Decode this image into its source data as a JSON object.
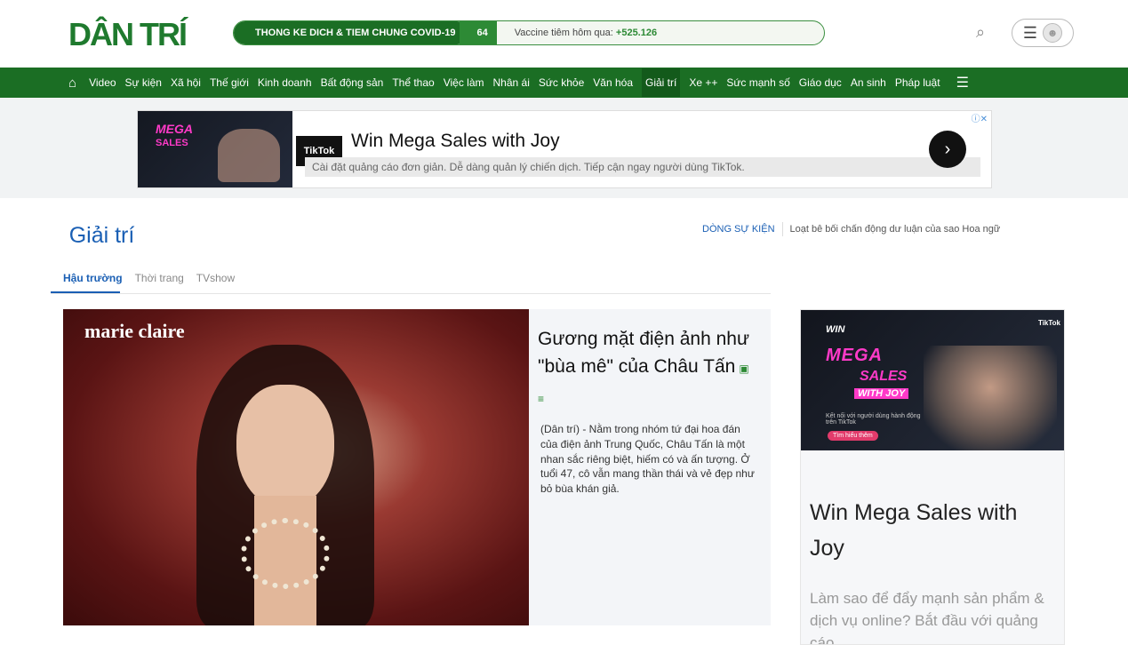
{
  "header": {
    "logo": "DÂN TRÍ",
    "covid_label": "THONG KE DICH & TIEM CHUNG COVID-19",
    "covid_count": "64",
    "vaccine_label": "Vaccine tiêm hôm qua:",
    "vaccine_value": "+525.126",
    "search_icon": "search-icon",
    "menu_icon": "hamburger-icon",
    "user_icon": "user-icon"
  },
  "nav": {
    "items": [
      "Video",
      "Sự kiện",
      "Xã hội",
      "Thế giới",
      "Kinh doanh",
      "Bất động sản",
      "Thể thao",
      "Việc làm",
      "Nhân ái",
      "Sức khỏe",
      "Văn hóa",
      "Giải trí",
      "Xe ++",
      "Sức mạnh số",
      "Giáo dục",
      "An sinh",
      "Pháp luật"
    ],
    "active": "Giải trí"
  },
  "top_ad": {
    "brand": "TikTok",
    "headline": "Win Mega Sales with Joy",
    "sub": "Cài đặt quảng cáo đơn giản. Dễ dàng quản lý chiến dịch. Tiếp cận ngay người dùng TikTok.",
    "img_line1": "MEGA",
    "img_line2": "SALES"
  },
  "section": {
    "title": "Giải trí",
    "event_tag": "DÒNG SỰ KIỆN",
    "event_text": "Loạt bê bối chấn động dư luận của sao Hoa ngữ",
    "tabs": [
      "Hậu trường",
      "Thời trang",
      "TVshow"
    ]
  },
  "article": {
    "photo_brand": "marie claire",
    "title": "Gương mặt điện ảnh như \"bùa mê\" của Châu Tấn",
    "summary": "(Dân trí) - Nằm trong nhóm tứ đại hoa đán của điện ảnh Trung Quốc, Châu Tấn là một nhan sắc riêng biệt, hiếm có và ấn tượng. Ở tuổi 47, cô vẫn mang thần thái và vẻ đẹp như bỏ bùa khán giả."
  },
  "side_ad": {
    "img_win": "WIN",
    "img_mega": "MEGA",
    "img_sales": "SALES",
    "img_with_joy": "WITH JOY",
    "img_small": "Kết nối với người dùng hành động trên TikTok",
    "img_cta": "Tìm hiểu thêm",
    "img_brand": "TikTok",
    "headline": "Win Mega Sales with Joy",
    "body": "Làm sao để đẩy mạnh sản phẩm & dịch vụ online? Bắt đầu với quảng cáo"
  }
}
